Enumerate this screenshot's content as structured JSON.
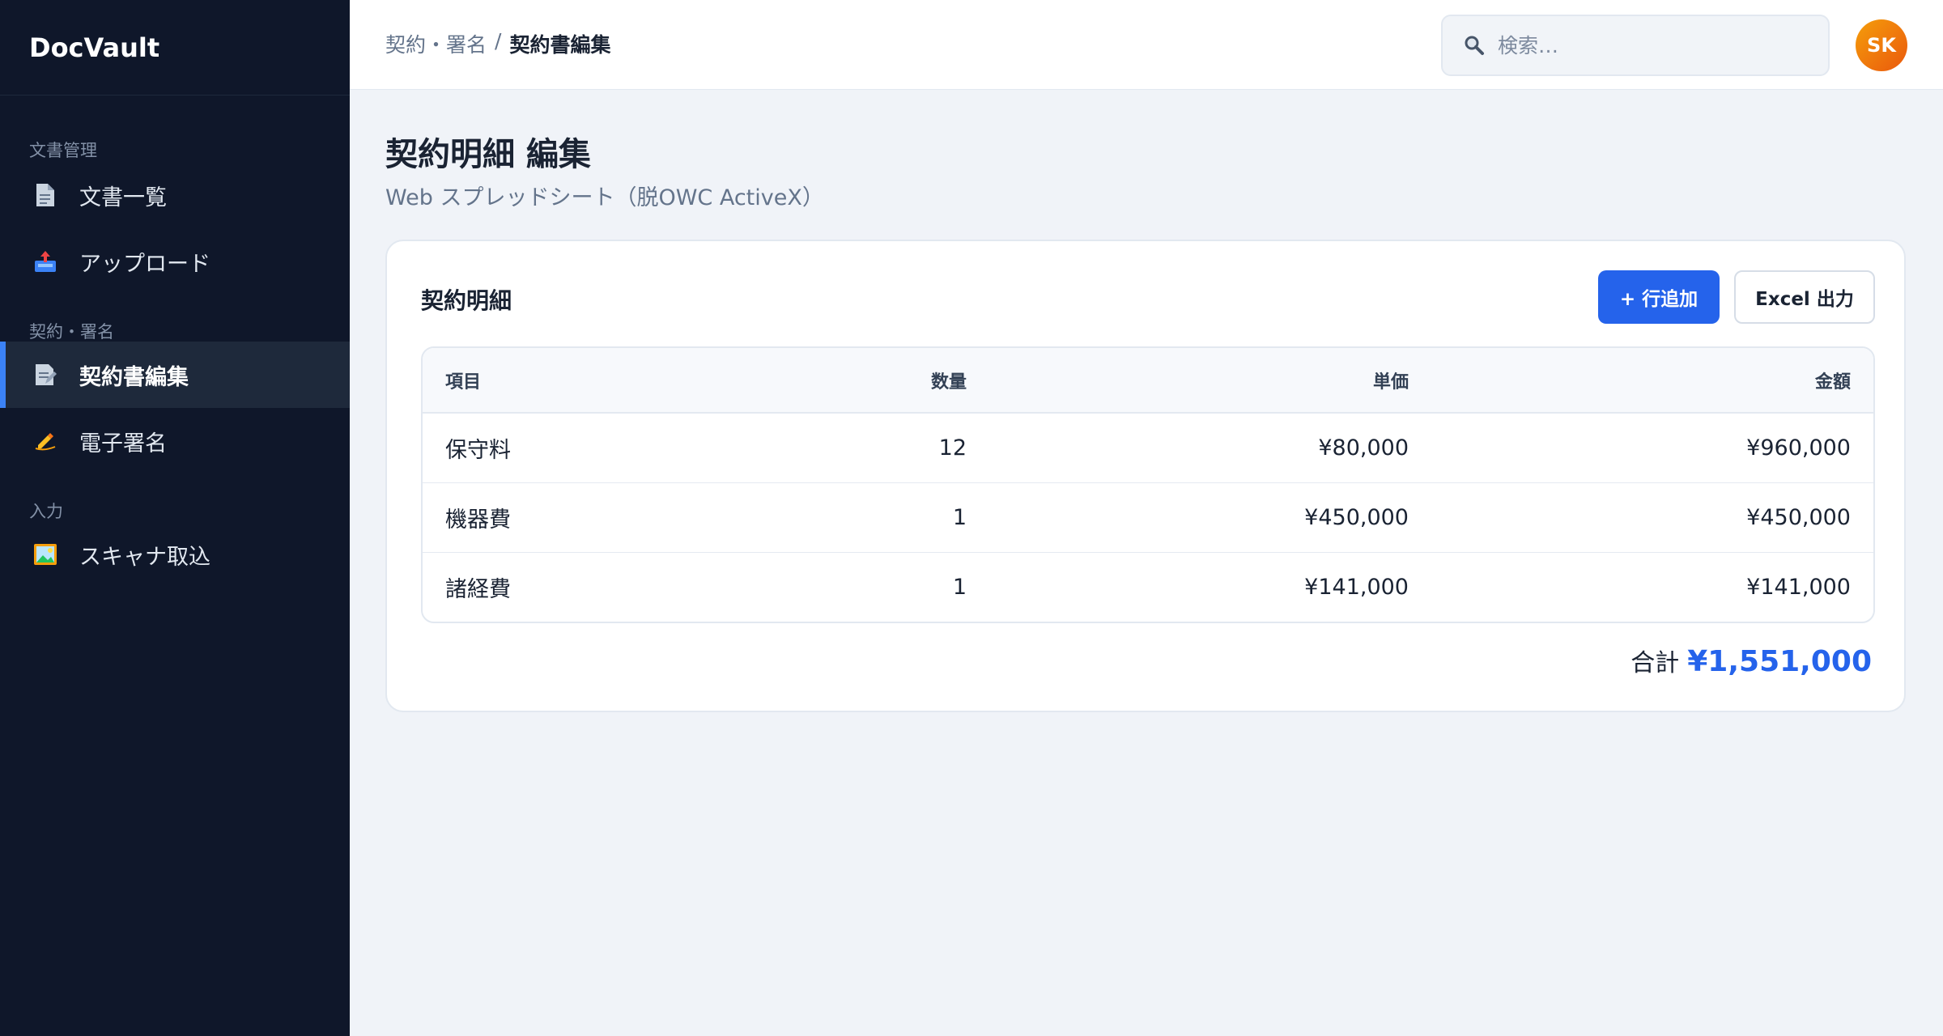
{
  "brand": "DocVault",
  "sidebar": {
    "sections": [
      {
        "label": "文書管理",
        "items": [
          {
            "label": "文書一覧",
            "icon": "document-icon",
            "active": false
          },
          {
            "label": "アップロード",
            "icon": "upload-tray-icon",
            "active": false
          }
        ]
      },
      {
        "label": "契約・署名",
        "items": [
          {
            "label": "契約書編集",
            "icon": "contract-edit-icon",
            "active": true
          },
          {
            "label": "電子署名",
            "icon": "signature-hand-icon",
            "active": false
          }
        ]
      },
      {
        "label": "入力",
        "items": [
          {
            "label": "スキャナ取込",
            "icon": "image-icon",
            "active": false
          }
        ]
      }
    ]
  },
  "header": {
    "breadcrumb": {
      "parent": "契約・署名",
      "separator": "/",
      "current": "契約書編集"
    },
    "search_placeholder": "検索…",
    "avatar_initials": "SK"
  },
  "main": {
    "title": "契約明細 編集",
    "subtitle": "Web スプレッドシート（脱OWC ActiveX）",
    "card": {
      "title": "契約明細",
      "add_row_label": "+ 行追加",
      "excel_label": "Excel 出力",
      "columns": [
        "項目",
        "数量",
        "単価",
        "金額"
      ],
      "rows": [
        [
          "保守料",
          "12",
          "¥80,000",
          "¥960,000"
        ],
        [
          "機器費",
          "1",
          "¥450,000",
          "¥450,000"
        ],
        [
          "諸経費",
          "1",
          "¥141,000",
          "¥141,000"
        ]
      ],
      "total_label": "合計",
      "total_value": "¥1,551,000"
    }
  },
  "colors": {
    "sidebar_bg": "#0f172a",
    "accent": "#2563eb",
    "avatar": "#ea580c"
  }
}
